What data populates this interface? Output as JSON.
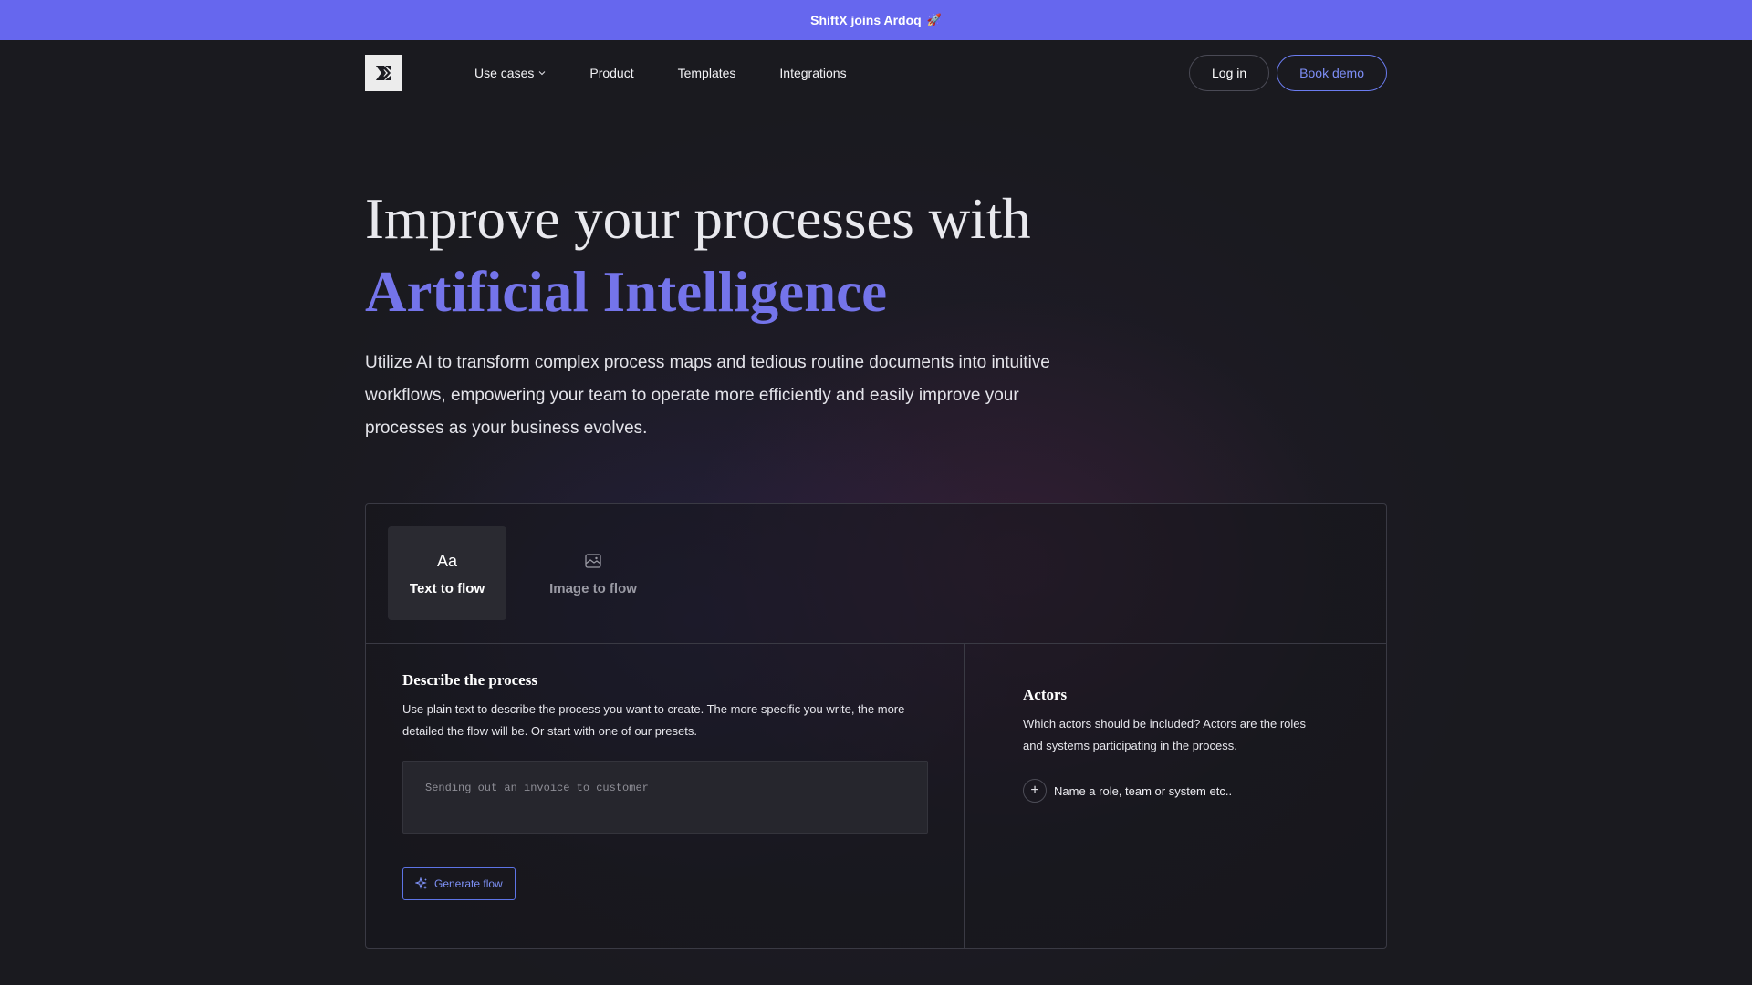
{
  "announcement": {
    "text": "ShiftX joins Ardoq",
    "emoji": "🚀",
    "color": "#6667ee"
  },
  "nav": {
    "logo_icon": "shiftx-logo-icon",
    "links": [
      {
        "label": "Use cases",
        "has_dropdown": true
      },
      {
        "label": "Product"
      },
      {
        "label": "Templates"
      },
      {
        "label": "Integrations"
      }
    ],
    "login_label": "Log in",
    "demo_label": "Book demo"
  },
  "hero": {
    "title_line1": "Improve your processes with",
    "title_accent": "Artificial Intelligence",
    "accent_color": "#7474ea",
    "subtitle": "Utilize AI to transform complex process maps and tedious routine documents into intuitive workflows, empowering your team to operate more efficiently and easily improve your processes as your business evolves."
  },
  "panel": {
    "tabs": [
      {
        "icon_text": "Aa",
        "label": "Text to flow",
        "active": true
      },
      {
        "icon": "image-icon",
        "label": "Image to flow",
        "active": false
      }
    ],
    "describe": {
      "title": "Describe the process",
      "description": "Use plain text to describe the process you want to create. The more specific you write, the more detailed the flow will be. Or start with one of our presets.",
      "placeholder": "Sending out an invoice to customer",
      "generate_label": "Generate flow"
    },
    "actors": {
      "title": "Actors",
      "description": "Which actors should be included? Actors are the roles and systems participating in the process.",
      "add_label": "Name a role, team or system etc.."
    }
  }
}
